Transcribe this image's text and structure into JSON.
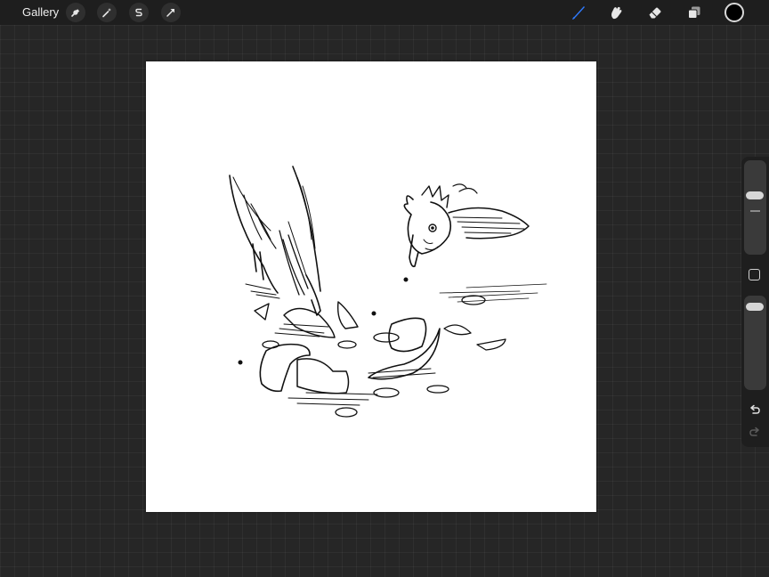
{
  "topbar": {
    "gallery_label": "Gallery",
    "left_tools": [
      {
        "name": "actions",
        "icon": "wrench-icon"
      },
      {
        "name": "adjustments",
        "icon": "magic-wand-icon"
      },
      {
        "name": "selection",
        "icon": "selection-s-icon"
      },
      {
        "name": "transform",
        "icon": "arrow-cursor-icon"
      }
    ],
    "right_tools": [
      {
        "name": "paint",
        "icon": "brush-icon",
        "active": true
      },
      {
        "name": "smudge",
        "icon": "smudge-finger-icon",
        "active": false
      },
      {
        "name": "erase",
        "icon": "eraser-icon",
        "active": false
      },
      {
        "name": "layers",
        "icon": "layers-icon",
        "active": false
      }
    ],
    "current_color": "#000000"
  },
  "colors": {
    "accent_blue": "#2f7bff",
    "icon_light": "#e6e6e6",
    "bar": "#1e1e1e",
    "workspace": "#262626",
    "canvas": "#ffffff"
  },
  "canvas": {
    "artwork": "pencil-sketch-two-chickens-pecking-eggshells"
  },
  "sidebar": {
    "brush_size_level": 0.65,
    "opacity_level": 0.95,
    "buttons": [
      {
        "name": "modify",
        "icon": "square-outline-icon"
      },
      {
        "name": "undo",
        "icon": "undo-arrow-icon"
      },
      {
        "name": "redo",
        "icon": "redo-arrow-icon"
      }
    ]
  }
}
